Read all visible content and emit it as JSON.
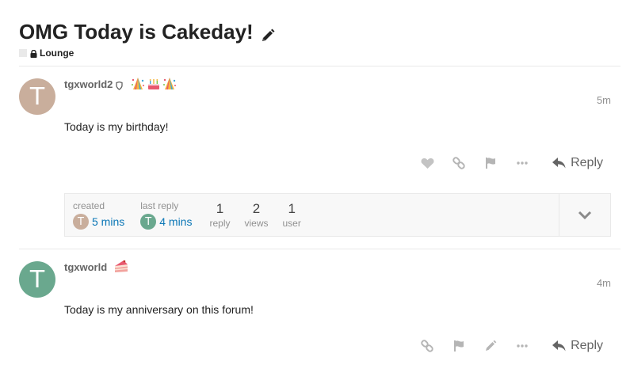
{
  "topic": {
    "title": "OMG Today is Cakeday!",
    "category": "Lounge"
  },
  "posts": [
    {
      "username": "tgxworld2",
      "avatar_letter": "T",
      "avatar_color": "#c9ae9c",
      "badge_icons": [
        "confetti-icon",
        "cake-icon",
        "confetti-icon"
      ],
      "date": "5m",
      "body": "Today is my birthday!",
      "reply_label": "Reply"
    },
    {
      "username": "tgxworld",
      "avatar_letter": "T",
      "avatar_color": "#6aa88e",
      "badge_icons": [
        "cake-slice-icon"
      ],
      "date": "4m",
      "body": "Today is my anniversary on this forum!",
      "reply_label": "Reply"
    }
  ],
  "topic_map": {
    "created_label": "created",
    "created_time": "5 mins",
    "last_reply_label": "last reply",
    "last_reply_time": "4 mins",
    "replies_count": "1",
    "replies_label": "reply",
    "views_count": "2",
    "views_label": "views",
    "users_count": "1",
    "users_label": "user"
  }
}
